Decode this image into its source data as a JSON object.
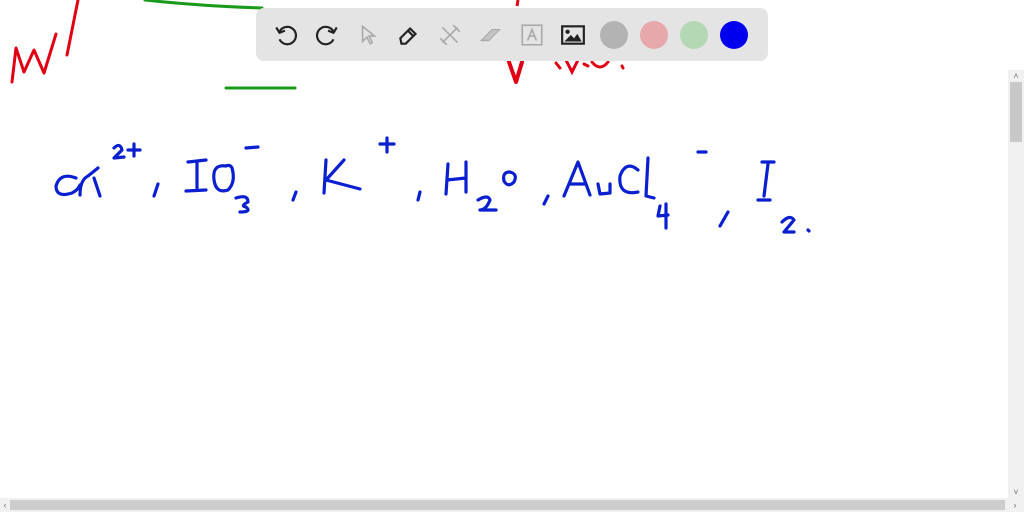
{
  "canvas": {
    "handwritten_text": "Cd²⁺, IO₃⁻, K⁺, H₂O, AuCl₄⁻, I₂.",
    "species": [
      "Cd2+",
      "IO3-",
      "K+",
      "H2O",
      "AuCl4-",
      "I2"
    ],
    "ink_colors": {
      "blue": "#0a1fd0",
      "red": "#e00012",
      "green": "#1a9a1a"
    }
  },
  "toolbar": {
    "tools": [
      {
        "name": "undo",
        "icon": "undo-icon",
        "enabled": true
      },
      {
        "name": "redo",
        "icon": "redo-icon",
        "enabled": true
      },
      {
        "name": "select",
        "icon": "pointer-icon",
        "enabled": false
      },
      {
        "name": "pen",
        "icon": "pen-icon",
        "enabled": true
      },
      {
        "name": "tools",
        "icon": "tools-icon",
        "enabled": false
      },
      {
        "name": "eraser",
        "icon": "eraser-icon",
        "enabled": false
      },
      {
        "name": "text",
        "icon": "text-icon",
        "enabled": false
      },
      {
        "name": "image",
        "icon": "image-icon",
        "enabled": true
      }
    ],
    "colors": [
      {
        "name": "gray",
        "hex": "#b3b3b3"
      },
      {
        "name": "red",
        "hex": "#e6a8ab"
      },
      {
        "name": "green",
        "hex": "#b3d8b3"
      },
      {
        "name": "blue",
        "hex": "#0000ee",
        "selected": true
      }
    ]
  },
  "scrollbars": {
    "vertical": {
      "up": "˄",
      "down": "˅"
    },
    "horizontal": {
      "left": "‹",
      "right": "›"
    }
  }
}
